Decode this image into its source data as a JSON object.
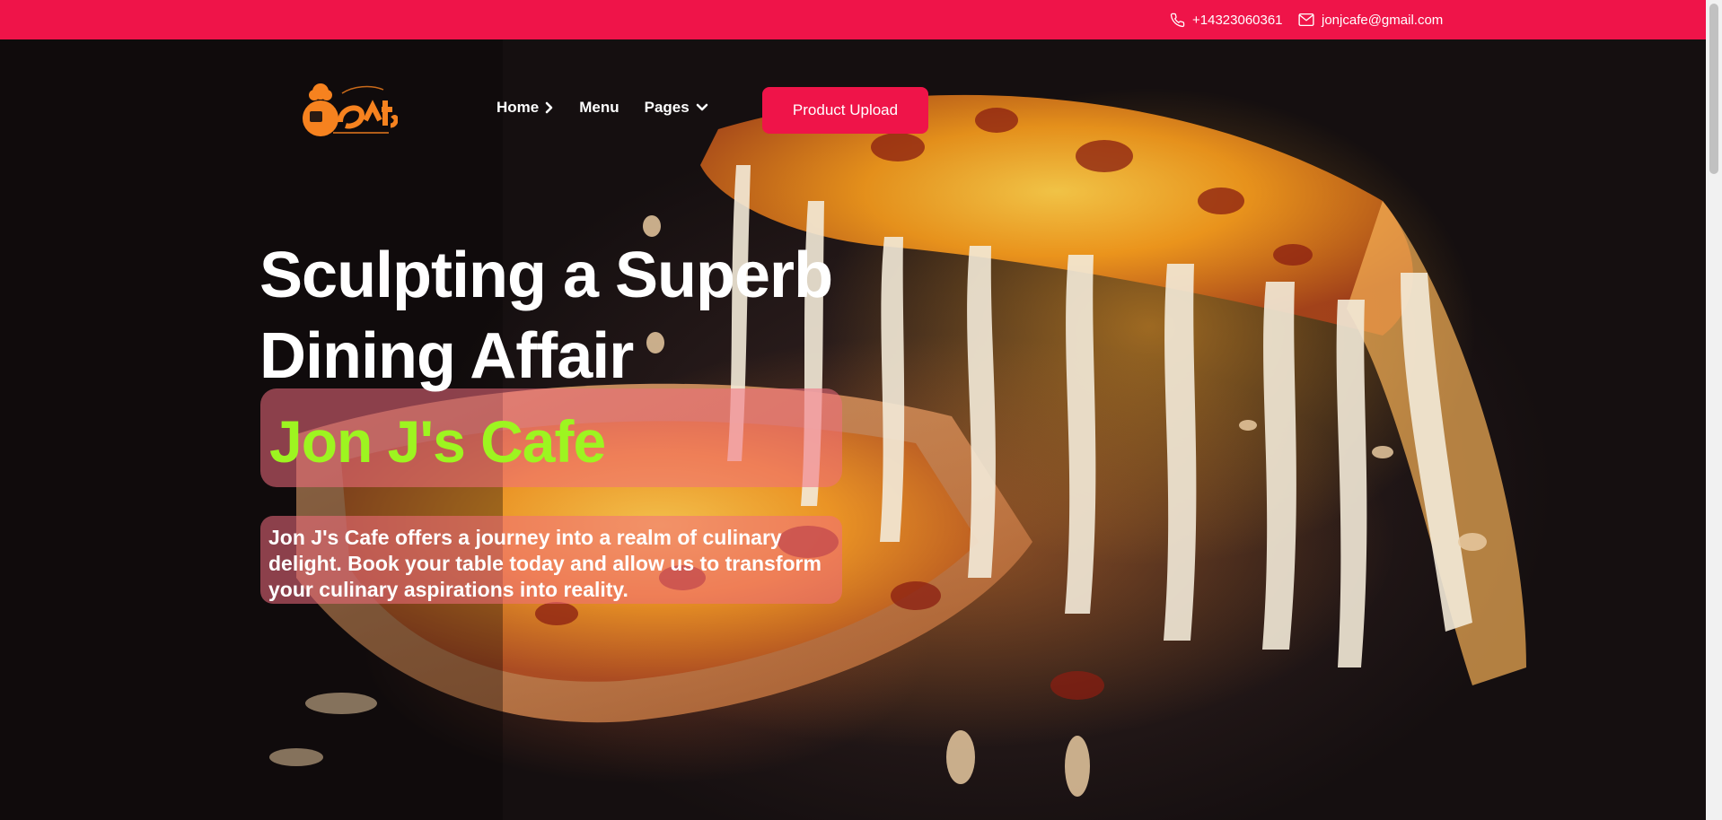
{
  "topbar": {
    "phone": "+14323060361",
    "email": "jonjcafe@gmail.com",
    "phone_icon": "phone-icon",
    "email_icon": "envelope-icon"
  },
  "logo": {
    "alt": "Jon J's Cafe logo"
  },
  "nav": {
    "items": [
      {
        "label": "Home",
        "icon": "chevron-right-icon"
      },
      {
        "label": "Menu"
      },
      {
        "label": "Pages",
        "icon": "chevron-down-icon"
      }
    ],
    "cta_label": "Product Upload"
  },
  "hero": {
    "headline_line1": "Sculpting a Superb",
    "headline_line2": "Dining Affair",
    "brand_name": "Jon J's Cafe",
    "description": "Jon J's Cafe offers a journey into a realm of culinary delight. Book your table today and allow us to transform your culinary aspirations into reality."
  },
  "colors": {
    "accent": "#ef1449",
    "brand_green": "#9df520",
    "overlay_pink": "#f26e80"
  }
}
